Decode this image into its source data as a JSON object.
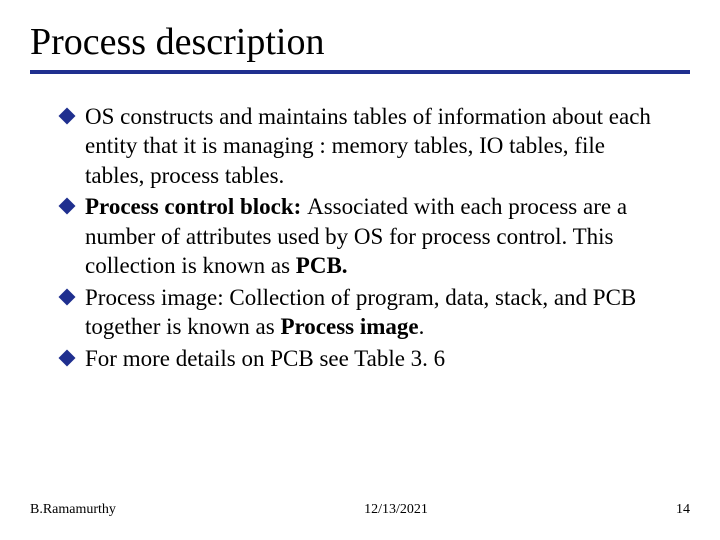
{
  "title": "Process description",
  "bullets": {
    "b0": {
      "pre": "",
      "bold": "",
      "post": "OS constructs and maintains tables of information about each entity that it is managing : memory tables, IO tables, file tables, process tables."
    },
    "b1": {
      "pre": "",
      "bold": "Process control block: ",
      "mid": "Associated with each process are a number of attributes used by OS for process control. This collection is known as ",
      "bold2": "PCB.",
      "post": ""
    },
    "b2": {
      "pre": "Process image: Collection of program, data, stack, and PCB together is known as ",
      "bold": "Process image",
      "post": "."
    },
    "b3": {
      "pre": "",
      "bold": "",
      "post": "For more details on PCB see Table 3. 6"
    }
  },
  "footer": {
    "author": "B.Ramamurthy",
    "date": "12/13/2021",
    "pagenum": "14"
  }
}
